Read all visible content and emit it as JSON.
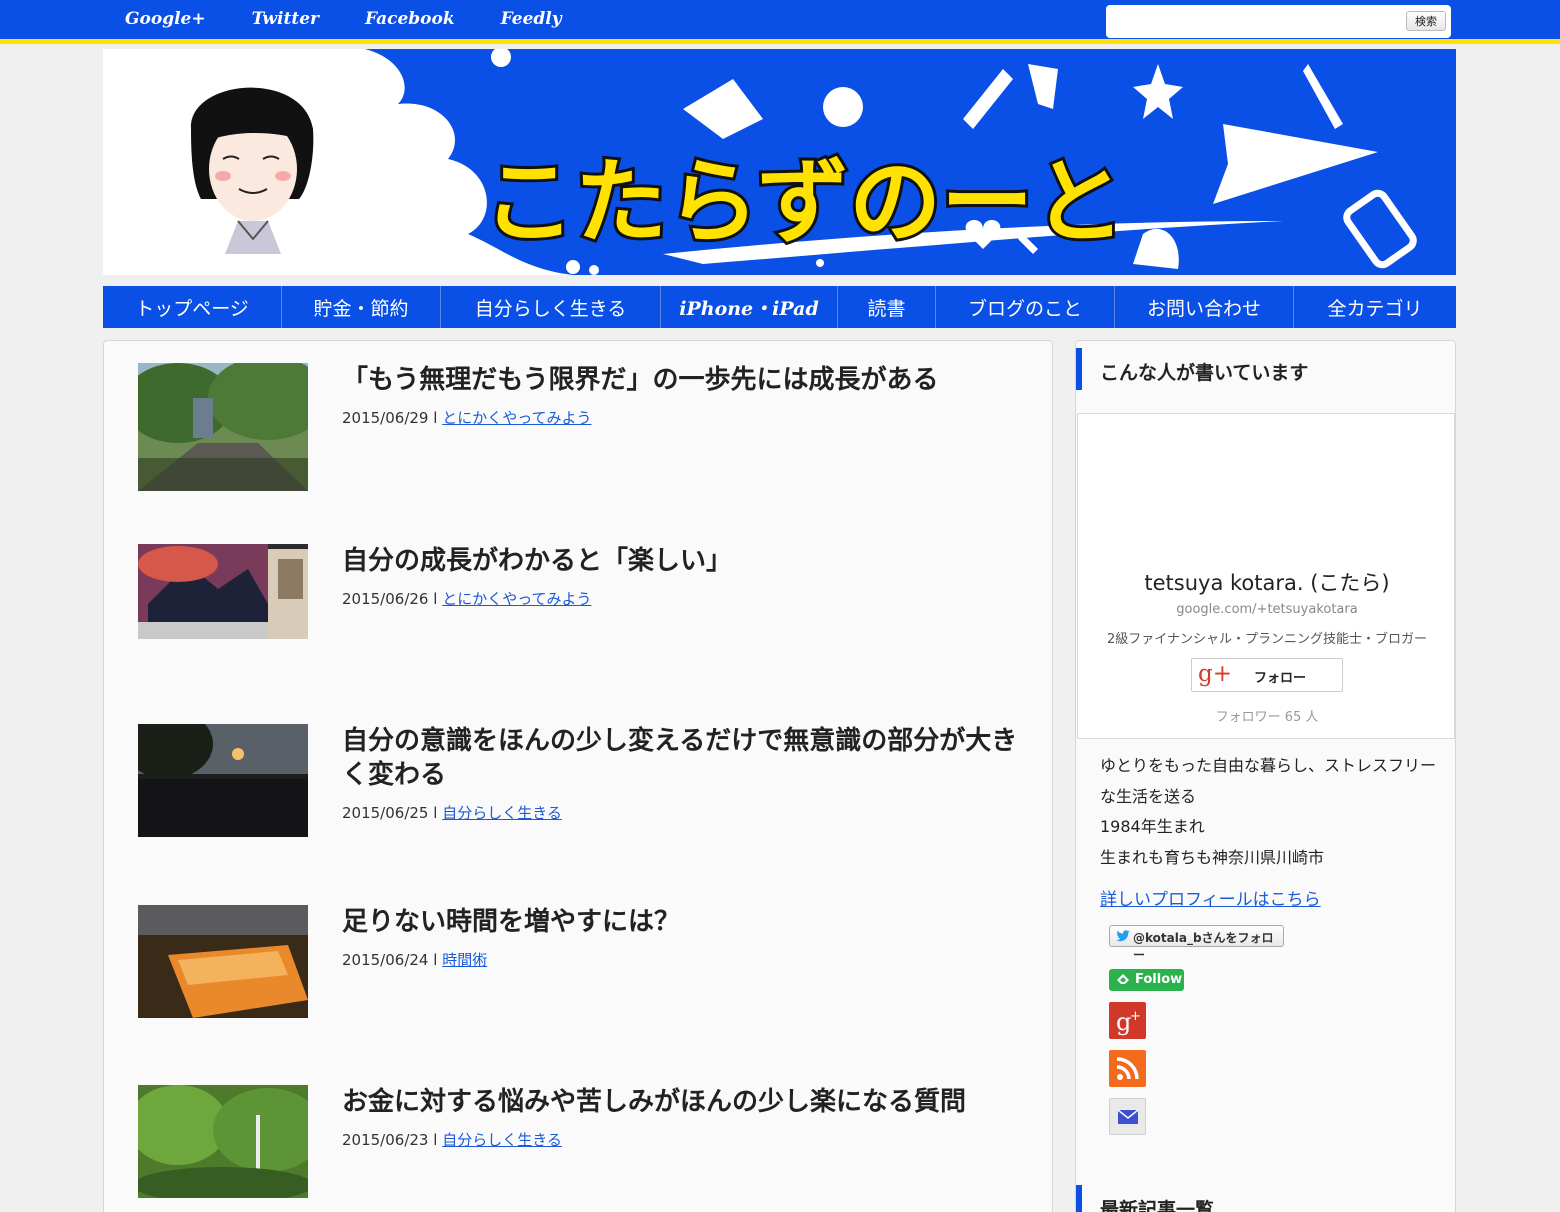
{
  "topbar": {
    "links": [
      "Google+",
      "Twitter",
      "Facebook",
      "Feedly"
    ],
    "search_placeholder": "",
    "search_button": "検索"
  },
  "banner": {
    "title": "こたらずのーと"
  },
  "nav": {
    "items": [
      "トップページ",
      "貯金・節約",
      "自分らしく生きる",
      "iPhone・iPad",
      "読書",
      "ブログのこと",
      "お問い合わせ",
      "全カテゴリ"
    ]
  },
  "posts": [
    {
      "title": "「もう無理だもう限界だ」の一歩先には成長がある",
      "date": "2015/06/29",
      "category": "とにかくやってみよう"
    },
    {
      "title": "自分の成長がわかると「楽しい」",
      "date": "2015/06/26",
      "category": "とにかくやってみよう"
    },
    {
      "title": "自分の意識をほんの少し変えるだけで無意識の部分が大きく変わる",
      "date": "2015/06/25",
      "category": "自分らしく生きる"
    },
    {
      "title": "足りない時間を増やすには？",
      "date": "2015/06/24",
      "category": "時間術"
    },
    {
      "title": "お金に対する悩みや苦しみがほんの少し楽になる質問",
      "date": "2015/06/23",
      "category": "自分らしく生きる"
    }
  ],
  "meta_separator": " l ",
  "sidebar": {
    "heading": "こんな人が書いています",
    "gplus": {
      "name": "tetsuya kotara. (こたら)",
      "url": "google.com/+tetsuyakotara",
      "desc": "2級ファイナンシャル・プランニング技能士・ブロガー",
      "follow_label": "フォロー",
      "g_glyph": "g+",
      "followers": "フォロワー 65 人"
    },
    "bio": [
      "ゆとりをもった自由な暮らし、ストレスフリーな生活を送る",
      "1984年生まれ",
      "生まれも育ちも神奈川県川崎市"
    ],
    "profile_link": "詳しいプロフィールはこちら",
    "twitter_follow": "@kotala_bさんをフォロー",
    "feedly_follow": "Follow",
    "heading2": "最新記事一覧"
  },
  "colors": {
    "brand_blue": "#0a4fe6",
    "accent_yellow": "#ffe200",
    "link": "#1a5ad8"
  },
  "icons": [
    "twitter-bird-icon",
    "feedly-icon",
    "google-plus-icon",
    "rss-icon",
    "mail-icon"
  ]
}
